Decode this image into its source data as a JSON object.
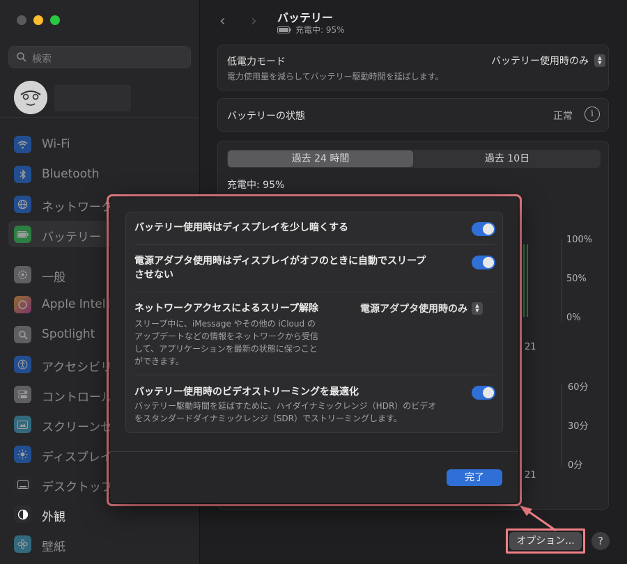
{
  "window": {
    "traffic_colors": [
      "#ff5f57",
      "#febc2e",
      "#28c840"
    ]
  },
  "sidebar": {
    "search_placeholder": "検索",
    "items": [
      {
        "label": "Wi-Fi",
        "icon": "wifi-icon",
        "color": "#1f6fe6"
      },
      {
        "label": "Bluetooth",
        "icon": "bluetooth-icon",
        "color": "#1f6fe6"
      },
      {
        "label": "ネットワーク",
        "icon": "globe-icon",
        "color": "#1f6fe6"
      },
      {
        "label": "バッテリー",
        "icon": "battery-icon",
        "color": "#34c759"
      },
      {
        "label": "一般",
        "icon": "gear-icon",
        "color": "#8e8e93"
      },
      {
        "label": "Apple Intelligence & Siri",
        "icon": "sparkle-icon",
        "color": "#c46a2a"
      },
      {
        "label": "Spotlight",
        "icon": "magnifier-icon",
        "color": "#8e8e93"
      },
      {
        "label": "アクセシビリティ",
        "icon": "accessibility-icon",
        "color": "#1f6fe6"
      },
      {
        "label": "コントロールセンター",
        "icon": "toggles-icon",
        "color": "#8e8e93"
      },
      {
        "label": "スクリーンセーバ",
        "icon": "screensaver-icon",
        "color": "#3fa0c4"
      },
      {
        "label": "ディスプレイ",
        "icon": "sun-icon",
        "color": "#1f6fe6"
      },
      {
        "label": "デスクトップとDock",
        "icon": "dock-icon",
        "color": "#2c2c2e"
      },
      {
        "label": "外観",
        "icon": "appearance-icon",
        "color": "#2c2c2e"
      },
      {
        "label": "壁紙",
        "icon": "flower-icon",
        "color": "#3fa0c4"
      }
    ]
  },
  "header": {
    "back": "‹",
    "forward": "›",
    "title": "バッテリー",
    "subtitle": "充電中: 95%"
  },
  "low_power": {
    "title": "低電力モード",
    "desc": "電力使用量を減らしてバッテリー駆動時間を延ばします。",
    "value": "バッテリー使用時のみ"
  },
  "battery_health": {
    "title": "バッテリーの状態",
    "value": "正常"
  },
  "history": {
    "tabs": [
      "過去 24 時間",
      "過去 10日"
    ],
    "status": "充電中: 95%",
    "level_axis": [
      "100%",
      "50%",
      "0%"
    ],
    "time_axis": [
      "60分",
      "30分",
      "0分"
    ],
    "x_label": "21"
  },
  "footer": {
    "options": "オプション...",
    "help": "?"
  },
  "dialog": {
    "rows": [
      {
        "title": "バッテリー使用時はディスプレイを少し暗くする",
        "toggle": true
      },
      {
        "title_line1": "電源アダプタ使用時はディスプレイがオフのときに自動でスリープ",
        "title_line2": "させない",
        "toggle": true
      },
      {
        "title": "ネットワークアクセスによるスリープ解除",
        "value": "電源アダプタ使用時のみ",
        "desc": [
          "スリープ中に、iMessage やその他の iCloud の",
          "アップデートなどの情報をネットワークから受信",
          "して、アプリケーションを最新の状態に保つこと",
          "ができます。"
        ]
      },
      {
        "title": "バッテリー使用時のビデオストリーミングを最適化",
        "toggle": true,
        "desc": [
          "バッテリー駆動時間を延ばすために、ハイダイナミックレンジ（HDR）のビデオ",
          "をスタンダードダイナミックレンジ（SDR）でストリーミングします。"
        ]
      }
    ],
    "done": "完了"
  }
}
